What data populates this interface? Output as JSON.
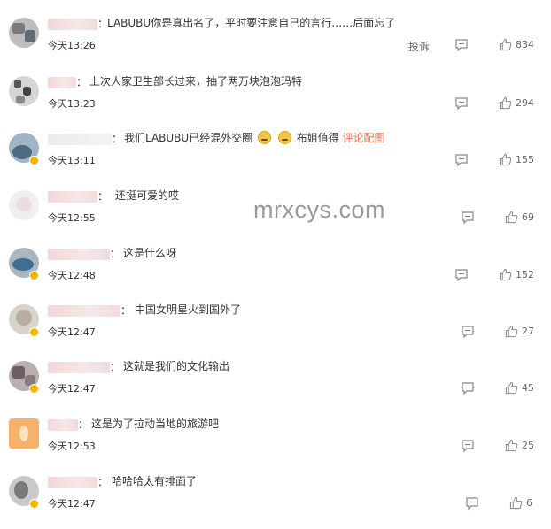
{
  "watermark": "mrxcys.com",
  "actions": {
    "report_label": "投诉"
  },
  "comments": [
    {
      "text": "LABUBU你是真出名了，平时要注意自己的言行……后面忘了",
      "time": "今天13:26",
      "likes": "834",
      "show_report": true
    },
    {
      "text": "上次人家卫生部长过来，抽了两万块泡泡玛特",
      "time": "今天13:23",
      "likes": "294"
    },
    {
      "text_before": "我们LABUBU已经混外交圈",
      "text_after": "布姐值得",
      "link": "评论配图",
      "emoji_icon": "crying-laugh-emoji",
      "time": "今天13:11",
      "likes": "155"
    },
    {
      "text": "还挺可爱的哎",
      "time": "今天12:55",
      "likes": "69"
    },
    {
      "text": "这是什么呀",
      "time": "今天12:48",
      "likes": "152"
    },
    {
      "text": "中国女明星火到国外了",
      "time": "今天12:47",
      "likes": "27"
    },
    {
      "text": "这就是我们的文化输出",
      "time": "今天12:47",
      "likes": "45"
    },
    {
      "text": "这是为了拉动当地的旅游吧",
      "time": "今天12:53",
      "likes": "25"
    },
    {
      "text": "哈哈哈太有排面了",
      "time": "今天12:47",
      "likes": "6"
    }
  ],
  "colors": {
    "link": "#eb7350",
    "badge": "#f7b500",
    "watermark": "#9a9a9a"
  }
}
